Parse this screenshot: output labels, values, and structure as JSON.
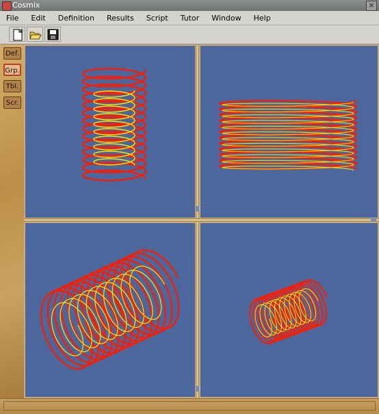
{
  "window": {
    "title": "Cosmix",
    "close_glyph": "×"
  },
  "menu": [
    "File",
    "Edit",
    "Definition",
    "Results",
    "Script",
    "Tutor",
    "Window",
    "Help"
  ],
  "toolbar": {
    "buttons": [
      "new-file-icon",
      "open-folder-icon",
      "save-disk-icon"
    ]
  },
  "sidebar": {
    "items": [
      {
        "label": "Def."
      },
      {
        "label": "Grp.",
        "active": true
      },
      {
        "label": "Tbl."
      },
      {
        "label": "Scr."
      }
    ]
  },
  "colors": {
    "plot_bg": "#4b679b",
    "coil_outer": "#ff1a00",
    "coil_inner": "#ffe600"
  },
  "status": {
    "text": ""
  }
}
